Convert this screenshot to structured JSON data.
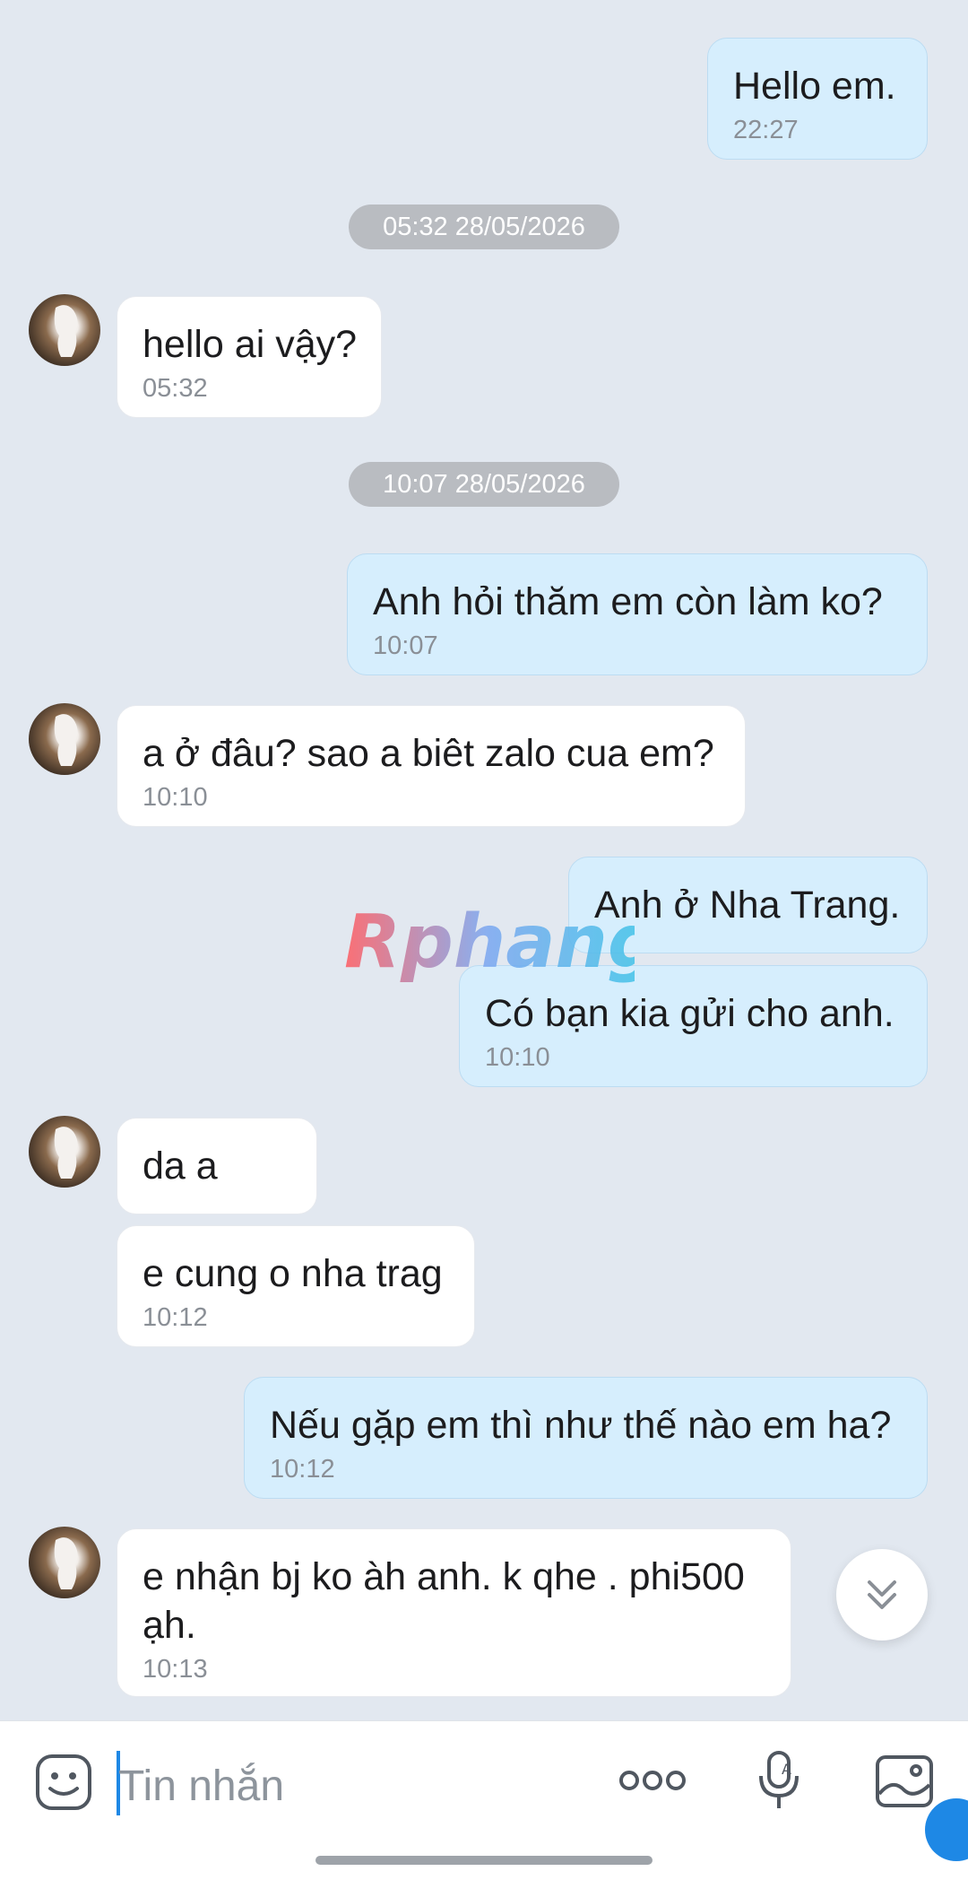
{
  "colors": {
    "sent_bubble": "#d6eefd",
    "received_bubble": "#ffffff",
    "background": "#e2e8f0",
    "accent": "#1e88e5"
  },
  "messages": [
    {
      "text": "Hello em.",
      "time": "22:27"
    },
    {
      "divider": "05:32 28/05/2026"
    },
    {
      "text": "hello ai vậy?",
      "time": "05:32"
    },
    {
      "divider": "10:07 28/05/2026"
    },
    {
      "text": "Anh hỏi thăm em còn làm ko?",
      "time": "10:07"
    },
    {
      "text": "a ở đâu? sao a biêt zalo cua em?",
      "time": "10:10"
    },
    {
      "text": "Anh ở Nha Trang."
    },
    {
      "text": "Có bạn kia gửi cho anh.",
      "time": "10:10"
    },
    {
      "text": "da a"
    },
    {
      "text": "e cung o nha trag",
      "time": "10:12"
    },
    {
      "text": "Nếu gặp em thì như thế nào em ha?",
      "time": "10:12"
    },
    {
      "text": "e nhận bj ko àh anh. k qhe . phi500 ạh.",
      "time": "10:13"
    }
  ],
  "watermark": "Rphang",
  "composer": {
    "placeholder": "Tin nhắn",
    "icons": [
      "emoji-icon",
      "more-icon",
      "mic-icon",
      "image-icon"
    ]
  }
}
